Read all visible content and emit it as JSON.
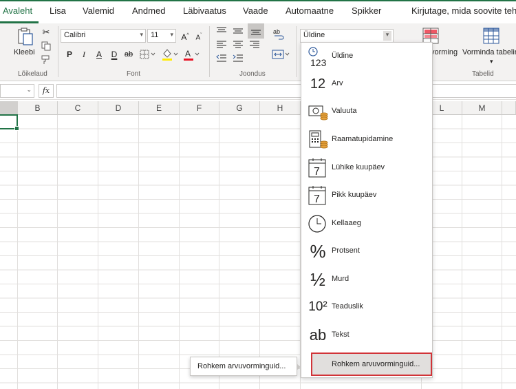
{
  "tabs": {
    "items": [
      "Avaleht",
      "Lisa",
      "Valemid",
      "Andmed",
      "Läbivaatus",
      "Vaade",
      "Automaatne",
      "Spikker"
    ],
    "active": "Avaleht",
    "tell_me": "Kirjutage, mida soovite teha"
  },
  "ribbon": {
    "clipboard": {
      "paste_label": "Kleebi",
      "group_label": "Lõikelaud"
    },
    "font": {
      "name": "Calibri",
      "size": "11",
      "bold": "P",
      "italic": "I",
      "underline": "A",
      "double_underline": "D",
      "strikethrough": "ab",
      "group_label": "Font"
    },
    "alignment": {
      "group_label": "Joondus"
    },
    "number": {
      "format": "Üldine"
    },
    "styles": {
      "conditional_formatting": "vorming",
      "format_as_table": "Vorminda tabelina"
    },
    "tables_group_label": "Tabelid"
  },
  "formula_bar": {
    "fx_label": "fx",
    "value": ""
  },
  "columns": [
    "B",
    "C",
    "D",
    "E",
    "F",
    "G",
    "H",
    "L",
    "M"
  ],
  "number_format_dropdown": {
    "items": [
      {
        "label": "Üldine",
        "icon": "general-icon",
        "icon_text": "123"
      },
      {
        "label": "Arv",
        "icon": "number-icon",
        "icon_text": "12"
      },
      {
        "label": "Valuuta",
        "icon": "currency-icon"
      },
      {
        "label": "Raamatupidamine",
        "icon": "accounting-icon"
      },
      {
        "label": "Lühike kuupäev",
        "icon": "short-date-icon",
        "icon_text": "7"
      },
      {
        "label": "Pikk kuupäev",
        "icon": "long-date-icon",
        "icon_text": "7"
      },
      {
        "label": "Kellaaeg",
        "icon": "time-icon"
      },
      {
        "label": "Protsent",
        "icon": "percent-icon",
        "icon_text": "%"
      },
      {
        "label": "Murd",
        "icon": "fraction-icon",
        "icon_text": "½"
      },
      {
        "label": "Teaduslik",
        "icon": "scientific-icon",
        "icon_text": "10²"
      },
      {
        "label": "Tekst",
        "icon": "text-icon",
        "icon_text": "ab"
      }
    ],
    "more_label": "Rohkem arvuvorminguid..."
  },
  "tooltip": {
    "text": "Rohkem arvuvorminguid..."
  },
  "colors": {
    "accent": "#217346",
    "highlight_border": "#d13438",
    "fill_color": "#ffeb00",
    "font_color": "#e81123"
  }
}
